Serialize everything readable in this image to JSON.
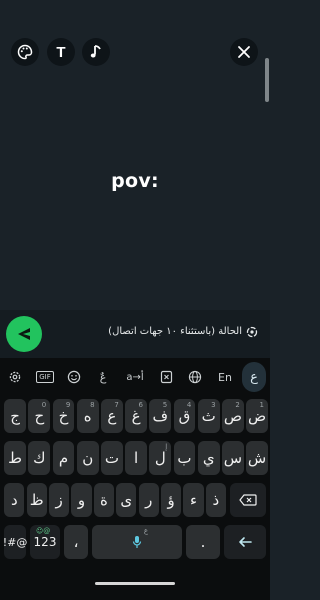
{
  "editor": {
    "caption": "pov:",
    "tools": {
      "palette_icon": "palette-icon",
      "text_label": "T",
      "music_icon": "music-note-icon",
      "close_icon": "close-icon"
    }
  },
  "status_row": {
    "text": "الحالة (باستثناء ١٠ جهات اتصال)",
    "send_icon": "send-icon",
    "audience_icon": "status-ring-icon"
  },
  "keyboard": {
    "toolbar": {
      "settings_icon": "gear-icon",
      "gif": "GIF",
      "emoji_icon": "emoji-icon",
      "diacritic": "عٌ",
      "translit": "a→أ",
      "clipboard_icon": "clipboard-icon",
      "globe_icon": "globe-icon",
      "lang": "En",
      "active_lang": "ع"
    },
    "row1": [
      {
        "k": "ض",
        "h": "1"
      },
      {
        "k": "ص",
        "h": "2"
      },
      {
        "k": "ث",
        "h": "3"
      },
      {
        "k": "ق",
        "h": "4"
      },
      {
        "k": "ف",
        "h": "5"
      },
      {
        "k": "غ",
        "h": "6"
      },
      {
        "k": "ع",
        "h": "7"
      },
      {
        "k": "ه",
        "h": "8"
      },
      {
        "k": "خ",
        "h": "9"
      },
      {
        "k": "ح",
        "h": "0"
      },
      {
        "k": "ج",
        "h": ""
      }
    ],
    "row2": [
      {
        "k": "ش",
        "h": ""
      },
      {
        "k": "س",
        "h": ""
      },
      {
        "k": "ي",
        "h": ""
      },
      {
        "k": "ب",
        "h": ""
      },
      {
        "k": "ل",
        "h": "إ"
      },
      {
        "k": "ا",
        "h": ""
      },
      {
        "k": "ت",
        "h": ""
      },
      {
        "k": "ن",
        "h": ""
      },
      {
        "k": "م",
        "h": ""
      },
      {
        "k": "ك",
        "h": ""
      },
      {
        "k": "ط",
        "h": ""
      }
    ],
    "row3": [
      {
        "k": "ذ",
        "h": ""
      },
      {
        "k": "ء",
        "h": ""
      },
      {
        "k": "ؤ",
        "h": ""
      },
      {
        "k": "ر",
        "h": ""
      },
      {
        "k": "ى",
        "h": ""
      },
      {
        "k": "ة",
        "h": ""
      },
      {
        "k": "و",
        "h": ""
      },
      {
        "k": "ز",
        "h": ""
      },
      {
        "k": "ظ",
        "h": ""
      },
      {
        "k": "د",
        "h": ""
      }
    ],
    "bottom": {
      "symbols": "!#@",
      "numbers": "123",
      "numbers_hint": "☺@",
      "comma": "،",
      "space_icon": "microphone-icon",
      "space_hint": "ع",
      "period": ".",
      "enter_icon": "enter-arrow-icon",
      "backspace_icon": "backspace-icon"
    }
  },
  "colors": {
    "send_button": "#22c35e",
    "editor_bg": "#1a2228",
    "keyboard_bg": "#0b0d0e",
    "key_bg": "#2c2f31"
  }
}
